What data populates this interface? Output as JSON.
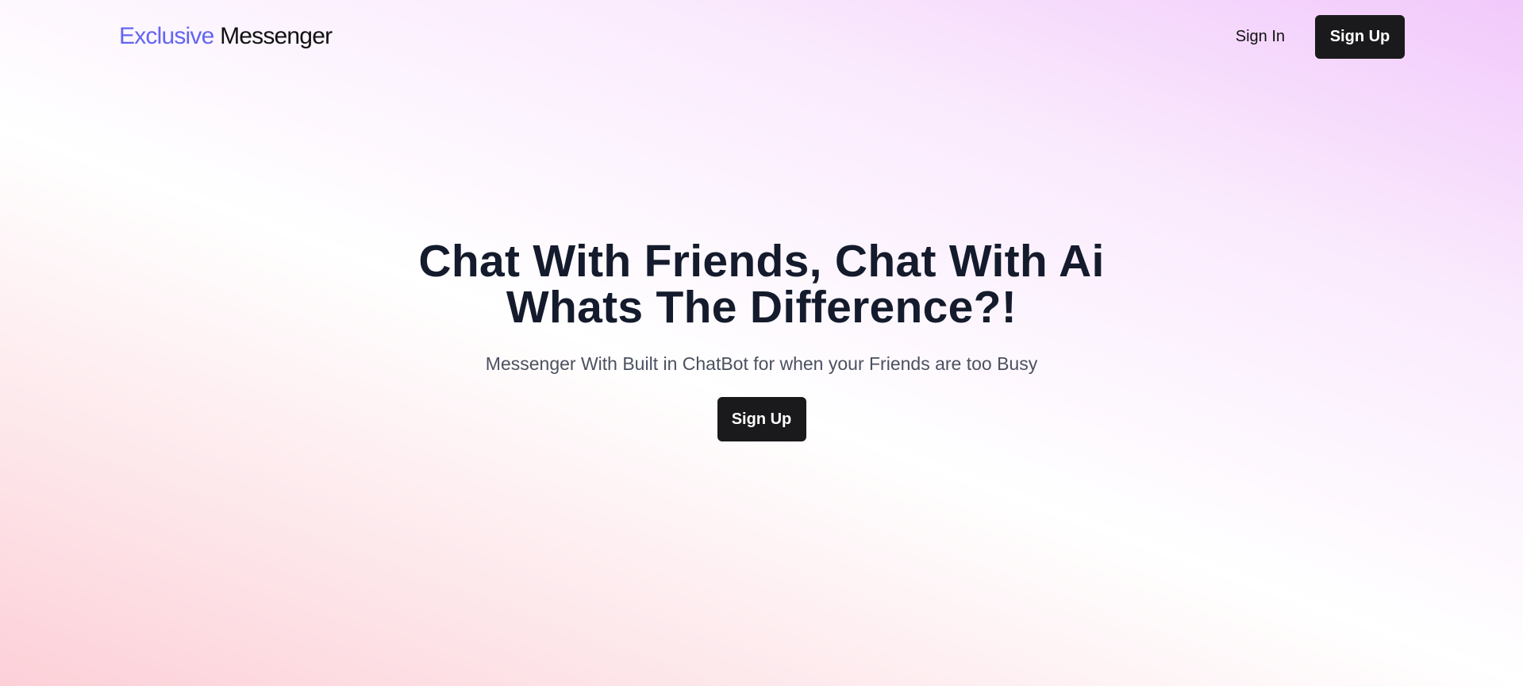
{
  "nav": {
    "brand_accent": "Exclusive",
    "brand_main": "Messenger",
    "signin_label": "Sign In",
    "signup_label": "Sign Up"
  },
  "hero": {
    "title_line1": "Chat With Friends, Chat With Ai",
    "title_line2": "Whats The Difference?!",
    "subtitle": "Messenger With Built in ChatBot for when your Friends are too Busy",
    "cta_label": "Sign Up"
  },
  "colors": {
    "brand_accent": "#6366f1",
    "button_bg": "#1a1a1c",
    "heading_text": "#141b2c",
    "gradient_top_right": "#f1c9fb",
    "gradient_bottom_left": "#fdd0d8"
  }
}
